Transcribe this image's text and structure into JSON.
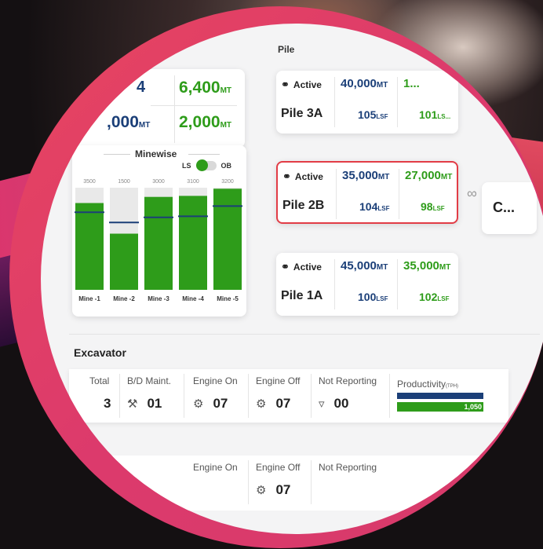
{
  "top_summary": {
    "row1_value_left": "4",
    "row1_value": "6,400",
    "row1_unit": "MT",
    "row2_value_left": ",000",
    "row2_unit_left": "MT",
    "row2_value": "2,000",
    "row2_unit": "MT"
  },
  "minewise": {
    "title": "Minewise",
    "toggle_left": "LS",
    "toggle_right": "OB"
  },
  "chart_data": {
    "type": "bar",
    "categories": [
      "Mine -1",
      "Mine -2",
      "Mine -3",
      "Mine -4",
      "Mine -5"
    ],
    "targets": [
      3500,
      1500,
      3000,
      3100,
      3200
    ],
    "target_labels": [
      "3500",
      "1500",
      "3000",
      "3100",
      "3200"
    ],
    "fill_fraction": [
      0.85,
      0.55,
      0.91,
      0.92,
      0.99
    ],
    "marker_fraction": [
      0.76,
      0.66,
      0.71,
      0.72,
      0.82
    ],
    "colors": {
      "bar": "#2e9c1a",
      "background": "#e9e9e9",
      "marker": "#1b3f78"
    }
  },
  "pile_section": {
    "header": "Pile"
  },
  "piles": [
    {
      "status": "Active",
      "name": "Pile 3A",
      "value1": "40,000",
      "unit1": "MT",
      "value2": "1...",
      "unit2": "",
      "sub1": "105",
      "subunit1": "LSF",
      "sub2": "101",
      "subunit2": "LS..."
    },
    {
      "status": "Active",
      "name": "Pile 2B",
      "value1": "35,000",
      "unit1": "MT",
      "value2": "27,000",
      "unit2": "MT",
      "sub1": "104",
      "subunit1": "LSF",
      "sub2": "98",
      "subunit2": "LSF"
    },
    {
      "status": "Active",
      "name": "Pile 1A",
      "value1": "45,000",
      "unit1": "MT",
      "value2": "35,000",
      "unit2": "MT",
      "sub1": "100",
      "subunit1": "LSF",
      "sub2": "102",
      "subunit2": "LSF"
    }
  ],
  "side_card": {
    "label": "C..."
  },
  "excavator": {
    "title": "Excavator",
    "total_label": "Total",
    "total_value": "3",
    "bd_label": "B/D Maint.",
    "bd_value": "01",
    "engine_on_label": "Engine On",
    "engine_on_value": "07",
    "engine_off_label": "Engine Off",
    "engine_off_value": "07",
    "not_reporting_label": "Not Reporting",
    "not_reporting_value": "00",
    "productivity_label": "Productivity",
    "productivity_unit": "(TPH)",
    "productivity_value": "1,050",
    "productivity_blue_fraction": 1.0,
    "productivity_green_fraction": 1.0
  },
  "second_row": {
    "engine_on_label": "Engine On",
    "engine_off_label": "Engine Off",
    "engine_off_value": "07",
    "not_reporting_label": "Not Reporting"
  }
}
